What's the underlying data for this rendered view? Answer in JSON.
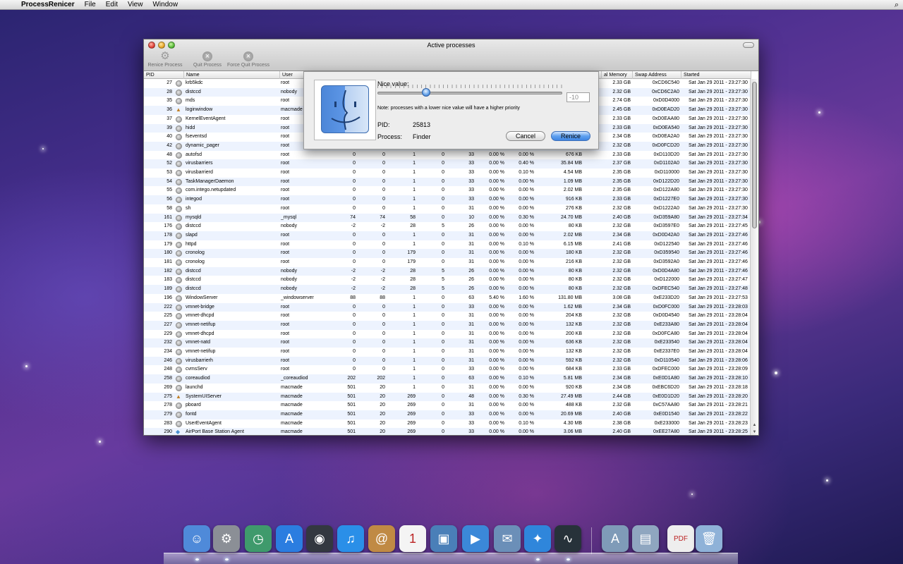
{
  "menubar": {
    "apple": "",
    "app": "ProcessRenicer",
    "items": [
      "File",
      "Edit",
      "View",
      "Window"
    ],
    "spotlight": "⌕"
  },
  "window": {
    "title": "Active processes"
  },
  "toolbar": {
    "renice": "Renice Process",
    "quit": "Quit Process",
    "force_quit": "Force Quit Process"
  },
  "columns": {
    "pid": "PID",
    "name": "Name",
    "user": "User",
    "memory": "al Memory",
    "swap": "Swap Address",
    "started": "Started"
  },
  "sheet": {
    "nice_label": "Nice value:",
    "nice_value": "-10",
    "note": "Note: processes with a lower nice value will have a higher priority",
    "pid_label": "PID:",
    "pid_value": "25813",
    "process_label": "Process:",
    "process_value": "Finder",
    "cancel": "Cancel",
    "renice": "Renice"
  },
  "rows": [
    [
      "27",
      "krb5kdc",
      "root",
      "",
      "",
      "",
      "",
      "",
      "",
      "",
      "",
      "2.33 GB",
      "0xCD6C540",
      "Sat Jan 29 2011 - 23:27:30",
      "g"
    ],
    [
      "28",
      "distccd",
      "nobody",
      "",
      "",
      "",
      "",
      "",
      "",
      "",
      "",
      "2.32 GB",
      "0xCD6C2A0",
      "Sat Jan 29 2011 - 23:27:30",
      "g"
    ],
    [
      "35",
      "mds",
      "root",
      "",
      "",
      "",
      "",
      "",
      "",
      "",
      "",
      "2.74 GB",
      "0xD0D4000",
      "Sat Jan 29 2011 - 23:27:30",
      "g"
    ],
    [
      "36",
      "loginwindow",
      "macmade",
      "",
      "",
      "",
      "",
      "",
      "",
      "",
      "",
      "2.45 GB",
      "0xD0EAD20",
      "Sat Jan 29 2011 - 23:27:30",
      "a"
    ],
    [
      "37",
      "KernelEventAgent",
      "root",
      "",
      "",
      "",
      "",
      "",
      "",
      "",
      "",
      "2.33 GB",
      "0xD0EAA80",
      "Sat Jan 29 2011 - 23:27:30",
      "g"
    ],
    [
      "39",
      "hidd",
      "root",
      "",
      "",
      "",
      "",
      "",
      "",
      "",
      "",
      "2.33 GB",
      "0xD0EA540",
      "Sat Jan 29 2011 - 23:27:30",
      "g"
    ],
    [
      "40",
      "fseventsd",
      "root",
      "",
      "",
      "",
      "",
      "",
      "",
      "",
      "",
      "2.34 GB",
      "0xD0EA2A0",
      "Sat Jan 29 2011 - 23:27:30",
      "g"
    ],
    [
      "42",
      "dynamic_pager",
      "root",
      "",
      "",
      "",
      "",
      "",
      "",
      "",
      "",
      "2.32 GB",
      "0xD0FCD20",
      "Sat Jan 29 2011 - 23:27:30",
      "g"
    ],
    [
      "48",
      "autofsd",
      "root",
      "0",
      "0",
      "1",
      "0",
      "33",
      "0.00 %",
      "0.00 %",
      "676 KB",
      "2.33 GB",
      "0xD110D20",
      "Sat Jan 29 2011 - 23:27:30",
      "g"
    ],
    [
      "52",
      "virusbarriers",
      "root",
      "0",
      "0",
      "1",
      "0",
      "33",
      "0.00 %",
      "0.40 %",
      "35.84 MB",
      "2.37 GB",
      "0xD1102A0",
      "Sat Jan 29 2011 - 23:27:30",
      "g"
    ],
    [
      "53",
      "virusbarrierd",
      "root",
      "0",
      "0",
      "1",
      "0",
      "33",
      "0.00 %",
      "0.10 %",
      "4.54 MB",
      "2.35 GB",
      "0xD110000",
      "Sat Jan 29 2011 - 23:27:30",
      "g"
    ],
    [
      "54",
      "TaskManagerDaemon",
      "root",
      "0",
      "0",
      "1",
      "0",
      "33",
      "0.00 %",
      "0.00 %",
      "1.09 MB",
      "2.35 GB",
      "0xD122D20",
      "Sat Jan 29 2011 - 23:27:30",
      "g"
    ],
    [
      "55",
      "com.intego.netupdated",
      "root",
      "0",
      "0",
      "1",
      "0",
      "33",
      "0.00 %",
      "0.00 %",
      "2.02 MB",
      "2.35 GB",
      "0xD122A80",
      "Sat Jan 29 2011 - 23:27:30",
      "g"
    ],
    [
      "56",
      "integod",
      "root",
      "0",
      "0",
      "1",
      "0",
      "33",
      "0.00 %",
      "0.00 %",
      "916 KB",
      "2.33 GB",
      "0xD1227E0",
      "Sat Jan 29 2011 - 23:27:30",
      "g"
    ],
    [
      "58",
      "sh",
      "root",
      "0",
      "0",
      "1",
      "0",
      "31",
      "0.00 %",
      "0.00 %",
      "276 KB",
      "2.32 GB",
      "0xD1222A0",
      "Sat Jan 29 2011 - 23:27:30",
      "g"
    ],
    [
      "161",
      "mysqld",
      "_mysql",
      "74",
      "74",
      "58",
      "0",
      "10",
      "0.00 %",
      "0.30 %",
      "24.70 MB",
      "2.40 GB",
      "0xD359A80",
      "Sat Jan 29 2011 - 23:27:34",
      "g"
    ],
    [
      "176",
      "distccd",
      "nobody",
      "-2",
      "-2",
      "28",
      "5",
      "26",
      "0.00 %",
      "0.00 %",
      "80 KB",
      "2.32 GB",
      "0xD3597E0",
      "Sat Jan 29 2011 - 23:27:45",
      "g"
    ],
    [
      "178",
      "slapd",
      "root",
      "0",
      "0",
      "1",
      "0",
      "31",
      "0.00 %",
      "0.00 %",
      "2.02 MB",
      "2.34 GB",
      "0xD0D42A0",
      "Sat Jan 29 2011 - 23:27:46",
      "g"
    ],
    [
      "179",
      "httpd",
      "root",
      "0",
      "0",
      "1",
      "0",
      "31",
      "0.00 %",
      "0.10 %",
      "6.15 MB",
      "2.41 GB",
      "0xD122540",
      "Sat Jan 29 2011 - 23:27:46",
      "g"
    ],
    [
      "180",
      "cronolog",
      "root",
      "0",
      "0",
      "179",
      "0",
      "31",
      "0.00 %",
      "0.00 %",
      "180 KB",
      "2.32 GB",
      "0xD359540",
      "Sat Jan 29 2011 - 23:27:46",
      "g"
    ],
    [
      "181",
      "cronolog",
      "root",
      "0",
      "0",
      "179",
      "0",
      "31",
      "0.00 %",
      "0.00 %",
      "216 KB",
      "2.32 GB",
      "0xD3592A0",
      "Sat Jan 29 2011 - 23:27:46",
      "g"
    ],
    [
      "182",
      "distccd",
      "nobody",
      "-2",
      "-2",
      "28",
      "5",
      "26",
      "0.00 %",
      "0.00 %",
      "80 KB",
      "2.32 GB",
      "0xD0D4A80",
      "Sat Jan 29 2011 - 23:27:46",
      "g"
    ],
    [
      "183",
      "distccd",
      "nobody",
      "-2",
      "-2",
      "28",
      "5",
      "26",
      "0.00 %",
      "0.00 %",
      "80 KB",
      "2.32 GB",
      "0xD122000",
      "Sat Jan 29 2011 - 23:27:47",
      "g"
    ],
    [
      "189",
      "distccd",
      "nobody",
      "-2",
      "-2",
      "28",
      "5",
      "26",
      "0.00 %",
      "0.00 %",
      "80 KB",
      "2.32 GB",
      "0xDFEC540",
      "Sat Jan 29 2011 - 23:27:48",
      "g"
    ],
    [
      "196",
      "WindowServer",
      "_windowserver",
      "88",
      "88",
      "1",
      "0",
      "63",
      "5.40 %",
      "1.60 %",
      "131.80 MB",
      "3.08 GB",
      "0xE233D20",
      "Sat Jan 29 2011 - 23:27:53",
      "g"
    ],
    [
      "222",
      "vmnet-bridge",
      "root",
      "0",
      "0",
      "1",
      "0",
      "33",
      "0.00 %",
      "0.00 %",
      "1.62 MB",
      "2.34 GB",
      "0xD0FC000",
      "Sat Jan 29 2011 - 23:28:03",
      "g"
    ],
    [
      "225",
      "vmnet-dhcpd",
      "root",
      "0",
      "0",
      "1",
      "0",
      "31",
      "0.00 %",
      "0.00 %",
      "204 KB",
      "2.32 GB",
      "0xD0D4540",
      "Sat Jan 29 2011 - 23:28:04",
      "g"
    ],
    [
      "227",
      "vmnet-netifup",
      "root",
      "0",
      "0",
      "1",
      "0",
      "31",
      "0.00 %",
      "0.00 %",
      "132 KB",
      "2.32 GB",
      "0xE233A80",
      "Sat Jan 29 2011 - 23:28:04",
      "g"
    ],
    [
      "229",
      "vmnet-dhcpd",
      "root",
      "0",
      "0",
      "1",
      "0",
      "31",
      "0.00 %",
      "0.00 %",
      "200 KB",
      "2.32 GB",
      "0xD0FCA80",
      "Sat Jan 29 2011 - 23:28:04",
      "g"
    ],
    [
      "232",
      "vmnet-natd",
      "root",
      "0",
      "0",
      "1",
      "0",
      "31",
      "0.00 %",
      "0.00 %",
      "636 KB",
      "2.32 GB",
      "0xE233540",
      "Sat Jan 29 2011 - 23:28:04",
      "g"
    ],
    [
      "234",
      "vmnet-netifup",
      "root",
      "0",
      "0",
      "1",
      "0",
      "31",
      "0.00 %",
      "0.00 %",
      "132 KB",
      "2.32 GB",
      "0xE2337E0",
      "Sat Jan 29 2011 - 23:28:04",
      "g"
    ],
    [
      "246",
      "virusbarrierh",
      "root",
      "0",
      "0",
      "1",
      "0",
      "31",
      "0.00 %",
      "0.00 %",
      "592 KB",
      "2.32 GB",
      "0xD110540",
      "Sat Jan 29 2011 - 23:28:06",
      "g"
    ],
    [
      "248",
      "cvmsServ",
      "root",
      "0",
      "0",
      "1",
      "0",
      "33",
      "0.00 %",
      "0.00 %",
      "684 KB",
      "2.33 GB",
      "0xDFEC000",
      "Sat Jan 29 2011 - 23:28:09",
      "g"
    ],
    [
      "258",
      "coreaudiod",
      "_coreaudiod",
      "202",
      "202",
      "1",
      "0",
      "63",
      "0.00 %",
      "0.10 %",
      "5.81 MB",
      "2.34 GB",
      "0xE0D1A80",
      "Sat Jan 29 2011 - 23:28:10",
      "g"
    ],
    [
      "269",
      "launchd",
      "macmade",
      "501",
      "20",
      "1",
      "0",
      "31",
      "0.00 %",
      "0.00 %",
      "920 KB",
      "2.34 GB",
      "0xEBC6D20",
      "Sat Jan 29 2011 - 23:28:18",
      "g"
    ],
    [
      "275",
      "SystemUIServer",
      "macmade",
      "501",
      "20",
      "269",
      "0",
      "48",
      "0.00 %",
      "0.30 %",
      "27.49 MB",
      "2.44 GB",
      "0xE0D1D20",
      "Sat Jan 29 2011 - 23:28:20",
      "a"
    ],
    [
      "278",
      "pboard",
      "macmade",
      "501",
      "20",
      "269",
      "0",
      "31",
      "0.00 %",
      "0.00 %",
      "488 KB",
      "2.32 GB",
      "0xC57AA80",
      "Sat Jan 29 2011 - 23:28:21",
      "g"
    ],
    [
      "279",
      "fontd",
      "macmade",
      "501",
      "20",
      "269",
      "0",
      "33",
      "0.00 %",
      "0.00 %",
      "20.69 MB",
      "2.40 GB",
      "0xE0D1540",
      "Sat Jan 29 2011 - 23:28:22",
      "g"
    ],
    [
      "283",
      "UserEventAgent",
      "macmade",
      "501",
      "20",
      "269",
      "0",
      "33",
      "0.00 %",
      "0.10 %",
      "4.30 MB",
      "2.38 GB",
      "0xE233000",
      "Sat Jan 29 2011 - 23:28:23",
      "g"
    ],
    [
      "290",
      "AirPort Base Station Agent",
      "macmade",
      "501",
      "20",
      "269",
      "0",
      "33",
      "0.00 %",
      "0.00 %",
      "3.06 MB",
      "2.40 GB",
      "0xEE27A80",
      "Sat Jan 29 2011 - 23:28:25",
      "w"
    ]
  ],
  "dock": [
    {
      "name": "Finder",
      "icon": "finder-icon",
      "color": "#4f8ad9",
      "glyph": "☺"
    },
    {
      "name": "System Preferences",
      "icon": "system-preferences-icon",
      "color": "#8b8f96",
      "glyph": "⚙"
    },
    {
      "name": "Time Machine",
      "icon": "time-machine-icon",
      "color": "#3f9a6c",
      "glyph": "◷"
    },
    {
      "name": "App Store",
      "icon": "app-store-icon",
      "color": "#2b7de0",
      "glyph": "A"
    },
    {
      "name": "Dashboard",
      "icon": "dashboard-icon",
      "color": "#333840",
      "glyph": "◉"
    },
    {
      "name": "iTunes",
      "icon": "itunes-icon",
      "color": "#2a8fe8",
      "glyph": "♫"
    },
    {
      "name": "Address Book",
      "icon": "address-book-icon",
      "color": "#c08a44",
      "glyph": "@"
    },
    {
      "name": "iCal",
      "icon": "ical-icon",
      "color": "#f4f4f4",
      "glyph": "1"
    },
    {
      "name": "iPhoto",
      "icon": "iphoto-icon",
      "color": "#4a7fb8",
      "glyph": "▣"
    },
    {
      "name": "FaceTime",
      "icon": "facetime-icon",
      "color": "#3b88d8",
      "glyph": "▶"
    },
    {
      "name": "Mail",
      "icon": "mail-icon",
      "color": "#6b8fb8",
      "glyph": "✉"
    },
    {
      "name": "Safari",
      "icon": "safari-icon",
      "color": "#2f86db",
      "glyph": "✦"
    },
    {
      "name": "Activity Monitor",
      "icon": "activity-monitor-icon",
      "color": "#27323a",
      "glyph": "∿"
    },
    {
      "name": "Applications",
      "icon": "applications-folder-icon",
      "color": "#7f9bb8",
      "glyph": "A"
    },
    {
      "name": "Documents",
      "icon": "documents-folder-icon",
      "color": "#8fa6c0",
      "glyph": "▤"
    },
    {
      "name": "PDF",
      "icon": "pdf-document-icon",
      "color": "#eeeeee",
      "glyph": "PDF"
    },
    {
      "name": "Trash",
      "icon": "trash-icon",
      "color": "#8fb2d8",
      "glyph": "🗑"
    }
  ]
}
